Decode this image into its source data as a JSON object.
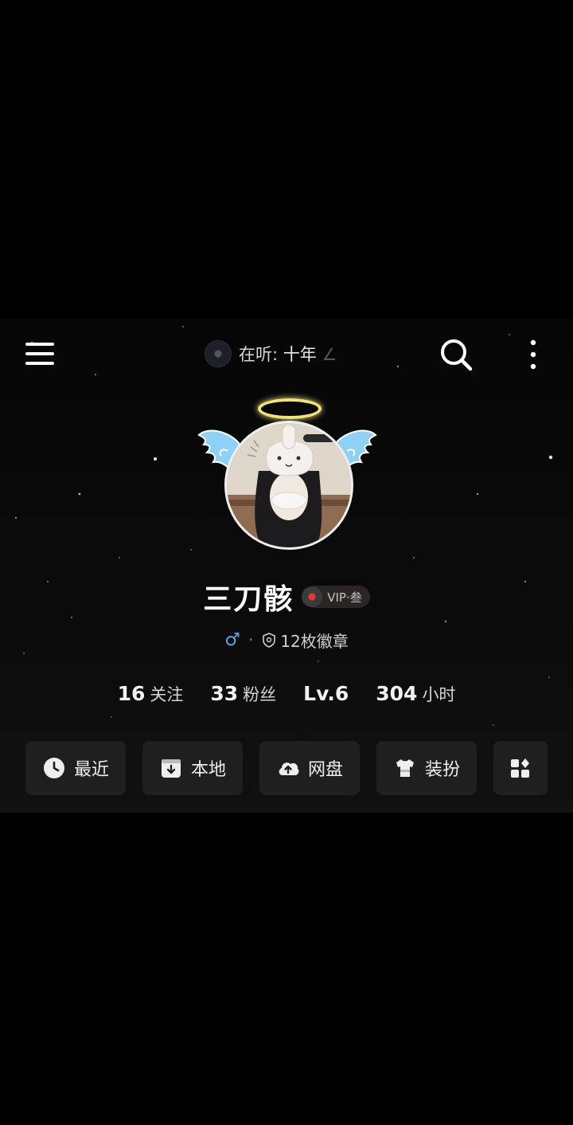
{
  "header": {
    "now_playing_prefix": "在听:",
    "now_playing_song": "十年",
    "now_playing_tail": "∠"
  },
  "profile": {
    "username": "三刀骸",
    "vip_label": "VIP·叁",
    "gender_symbol": "♂",
    "separator": "·",
    "badges_text": "12枚徽章"
  },
  "stats": [
    {
      "value": "16",
      "label": "关注"
    },
    {
      "value": "33",
      "label": "粉丝"
    },
    {
      "value": "Lv.6",
      "label": ""
    },
    {
      "value": "304",
      "label": "小时"
    }
  ],
  "quick_actions": [
    {
      "label": "最近",
      "icon": "clock-icon"
    },
    {
      "label": "本地",
      "icon": "download-box-icon"
    },
    {
      "label": "网盘",
      "icon": "cloud-upload-icon"
    },
    {
      "label": "装扮",
      "icon": "shirt-icon"
    },
    {
      "label": "",
      "icon": "grid-plus-icon"
    }
  ],
  "colors": {
    "background": "#000000",
    "panel": "#0b0b0b",
    "button": "#1f1f1f",
    "gender": "#5aa9e6",
    "halo": "#f3e27a",
    "wings": "#8fd0f5"
  }
}
